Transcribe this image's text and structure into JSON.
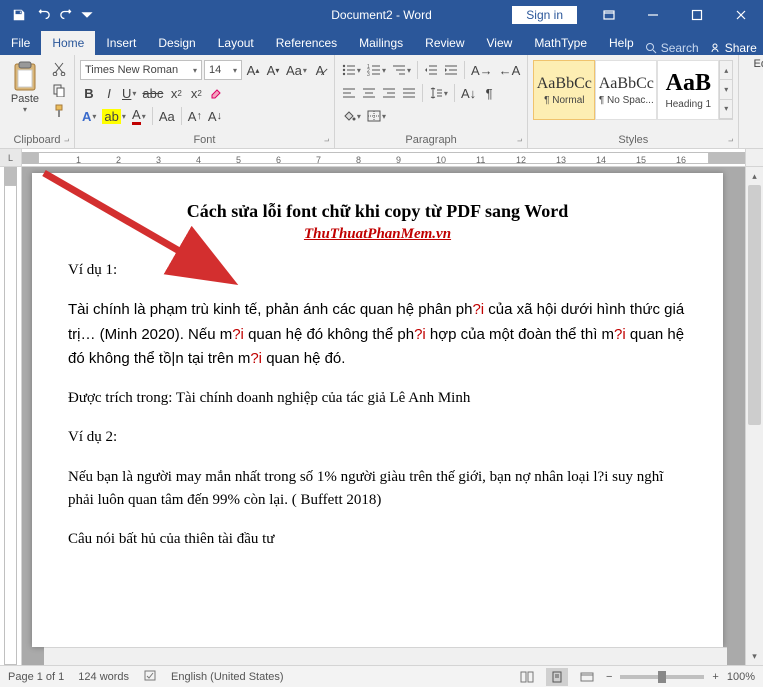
{
  "titlebar": {
    "title": "Document2 - Word",
    "sign_in": "Sign in"
  },
  "tabs": {
    "file": "File",
    "home": "Home",
    "insert": "Insert",
    "design": "Design",
    "layout": "Layout",
    "references": "References",
    "mailings": "Mailings",
    "review": "Review",
    "view": "View",
    "mathtype": "MathType",
    "help": "Help",
    "search": "Search",
    "share": "Share"
  },
  "ribbon": {
    "clipboard": {
      "label": "Clipboard",
      "paste": "Paste"
    },
    "font": {
      "label": "Font",
      "name": "Times New Roman",
      "size": "14"
    },
    "paragraph": {
      "label": "Paragraph"
    },
    "styles": {
      "label": "Styles",
      "items": [
        {
          "preview": "AaBbCc",
          "name": "¶ Normal"
        },
        {
          "preview": "AaBbCc",
          "name": "¶ No Spac..."
        },
        {
          "preview": "AaB",
          "name": "Heading 1"
        }
      ]
    },
    "editing": {
      "label": "Editing"
    }
  },
  "doc": {
    "title": "Cách sửa lỗi font chữ khi copy từ PDF sang Word",
    "site": "ThuThuatPhanMem.vn",
    "p1": "Ví dụ 1:",
    "p2a": "Tài chính là phạm trù kinh tế, phản ánh các quan hệ phân ph",
    "p2e1": "?i",
    "p2b": " của xã hội dưới hình thức giá trị… (Minh 2020). Nếu m",
    "p2e2": "?i",
    "p2c": " quan hệ đó không thể ph",
    "p2e3": "?i",
    "p2d": " hợp của một đoàn thể thì m",
    "p2e4": "?i",
    "p2e": " quan hệ đó không thể tồ|n tại trên m",
    "p2e5": "?i",
    "p2f": " quan hệ đó.",
    "p3": "Được trích trong: Tài chính doanh nghiệp của tác giả Lê Anh Minh",
    "p4": "Ví dụ 2:",
    "p5": "Nếu bạn là người may mắn nhất trong số 1% người giàu trên thế giới, bạn nợ nhân loại l?i suy nghĩ phải luôn quan tâm đến 99% còn lại. ( Buffett 2018)",
    "p6": "Câu nói bất hủ của thiên tài đầu tư"
  },
  "status": {
    "page": "Page 1 of 1",
    "words": "124 words",
    "lang": "English (United States)",
    "zoom": "100%"
  }
}
